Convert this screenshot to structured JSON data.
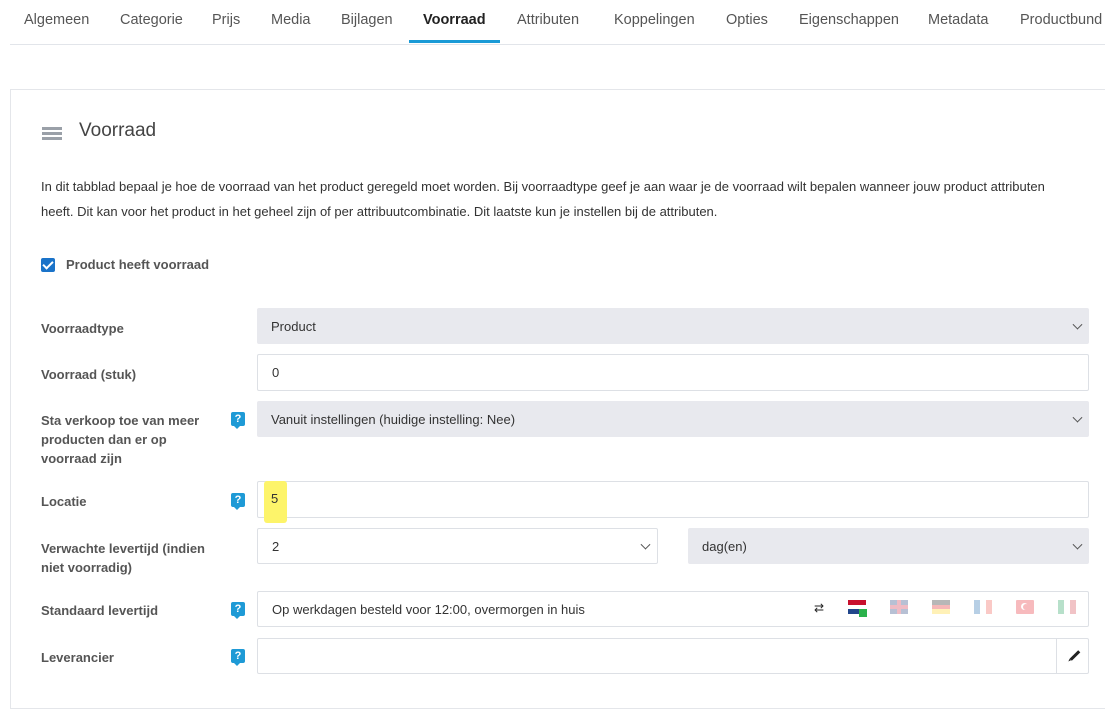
{
  "tabs": [
    "Algemeen",
    "Categorie",
    "Prijs",
    "Media",
    "Bijlagen",
    "Voorraad",
    "Attributen",
    "Koppelingen",
    "Opties",
    "Eigenschappen",
    "Metadata",
    "Productbund"
  ],
  "active_tab": "Voorraad",
  "section": {
    "title": "Voorraad",
    "intro": "In dit tabblad bepaal je hoe de voorraad van het product geregeld moet worden. Bij voorraadtype geef je aan waar je de voorraad wilt bepalen wanneer jouw product attributen heeft. Dit kan voor het product in het geheel zijn of per attribuutcombinatie. Dit laatste kun je instellen bij de attributen."
  },
  "has_stock": {
    "label": "Product heeft voorraad",
    "checked": true
  },
  "fields": {
    "stock_type": {
      "label": "Voorraadtype",
      "value": "Product"
    },
    "stock_qty": {
      "label": "Voorraad (stuk)",
      "value": "0"
    },
    "oversell": {
      "label": "Sta verkoop toe van meer producten dan er op voorraad zijn",
      "value": "Vanuit instellingen (huidige instelling: Nee)"
    },
    "location": {
      "label": "Locatie",
      "value": "5"
    },
    "lead_time": {
      "label": "Verwachte levertijd (indien niet voorradig)",
      "value": "2",
      "unit": "dag(en)"
    },
    "std_lead_time": {
      "label": "Standaard levertijd",
      "value": "Op werkdagen besteld voor 12:00, overmorgen in huis"
    },
    "supplier": {
      "label": "Leverancier",
      "value": ""
    }
  },
  "help_glyph": "?",
  "swap_glyph": "⇄",
  "colors": {
    "accent": "#1a9ad6",
    "highlight": "#fdf46a",
    "select_bg": "#e8e9ee"
  },
  "flags": [
    "nl-flag",
    "gb-flag",
    "de-flag",
    "fr-flag",
    "tr-flag",
    "it-flag"
  ]
}
